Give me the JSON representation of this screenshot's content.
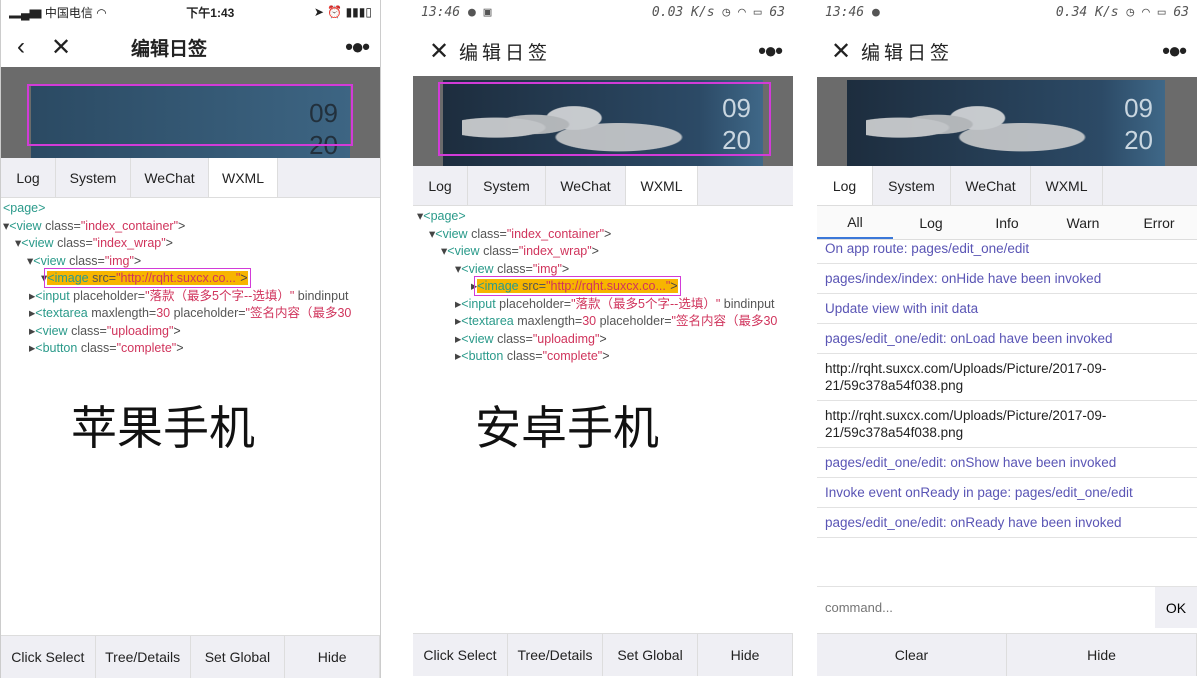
{
  "phone1": {
    "carrier": "中国电信",
    "time": "下午1:43",
    "title": "编辑日签",
    "date_month": "09",
    "date_day": "20",
    "tabs": [
      "Log",
      "System",
      "WeChat",
      "WXML"
    ],
    "label": "苹果手机",
    "bottom": [
      "Click Select",
      "Tree/Details",
      "Set Global",
      "Hide"
    ]
  },
  "phone2": {
    "time": "13:46",
    "speed": "0.03 K/s",
    "battery": "63",
    "title": "编辑日签",
    "date_month": "09",
    "date_day": "20",
    "tabs": [
      "Log",
      "System",
      "WeChat",
      "WXML"
    ],
    "label": "安卓手机",
    "bottom": [
      "Click Select",
      "Tree/Details",
      "Set Global",
      "Hide"
    ]
  },
  "phone3": {
    "time": "13:46",
    "speed": "0.34 K/s",
    "battery": "63",
    "title": "编辑日签",
    "date_month": "09",
    "date_day": "20",
    "tabs": [
      "Log",
      "System",
      "WeChat",
      "WXML"
    ],
    "subtabs": [
      "All",
      "Log",
      "Info",
      "Warn",
      "Error"
    ],
    "logs": [
      "On app route: pages/edit_one/edit",
      "pages/index/index: onHide have been invoked",
      "Update view with init data",
      "pages/edit_one/edit: onLoad have been invoked",
      "http://rqht.suxcx.com/Uploads/Picture/2017-09-21/59c378a54f038.png",
      "http://rqht.suxcx.com/Uploads/Picture/2017-09-21/59c378a54f038.png",
      "pages/edit_one/edit: onShow have been invoked",
      "Invoke event onReady in page: pages/edit_one/edit",
      "pages/edit_one/edit: onReady have been invoked"
    ],
    "command_placeholder": "command...",
    "ok": "OK",
    "bottom": [
      "Clear",
      "Hide"
    ]
  },
  "tree": {
    "page": "<page>",
    "container": "index_container",
    "wrap": "index_wrap",
    "img": "img",
    "image_src": "http://rqht.suxcx.co...",
    "input_ph": "落款（最多5个字--选填）",
    "input_tail": "bindinput",
    "textarea_max": "30",
    "textarea_ph": "签名内容（最多30",
    "uploadimg": "uploadimg",
    "complete": "complete"
  }
}
